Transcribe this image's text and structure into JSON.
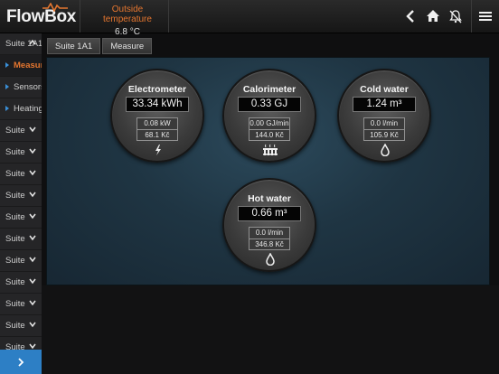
{
  "app": {
    "title": "FlowBox"
  },
  "header": {
    "outside_label": "Outside temperature",
    "outside_value": "6.8 °C",
    "icons": [
      "back-icon",
      "home-icon",
      "alarm-muted-icon",
      "menu-icon"
    ]
  },
  "sidebar": {
    "items": [
      {
        "label": "Suite 1A1",
        "expanded": true
      },
      {
        "label": "Measure",
        "sub": true,
        "active": true
      },
      {
        "label": "Sensors",
        "sub": true
      },
      {
        "label": "Heating",
        "sub": true
      },
      {
        "label": "Suite"
      },
      {
        "label": "Suite"
      },
      {
        "label": "Suite"
      },
      {
        "label": "Suite"
      },
      {
        "label": "Suite"
      },
      {
        "label": "Suite"
      },
      {
        "label": "Suite"
      },
      {
        "label": "Suite"
      },
      {
        "label": "Suite"
      },
      {
        "label": "Suite"
      },
      {
        "label": "Suite"
      }
    ],
    "expand_icon": "chevron-right-icon"
  },
  "breadcrumb": [
    "Suite 1A1",
    "Measure"
  ],
  "meters": {
    "electrometer": {
      "title": "Electrometer",
      "value": "33.34 kWh",
      "rate": "0.08 kW",
      "cost": "68.1 Kč",
      "icon": "lightning-icon"
    },
    "calorimeter": {
      "title": "Calorimeter",
      "value": "0.33 GJ",
      "rate": "0.00 GJ/min",
      "cost": "144.0 Kč",
      "icon": "radiator-icon"
    },
    "cold_water": {
      "title": "Cold water",
      "value": "1.24 m³",
      "rate": "0.0 l/min",
      "cost": "105.9 Kč",
      "icon": "drop-icon"
    },
    "hot_water": {
      "title": "Hot water",
      "value": "0.66 m³",
      "rate": "0.0 l/min",
      "cost": "346.8 Kč",
      "icon": "drop-icon"
    }
  },
  "colors": {
    "accent": "#e5762f",
    "blue": "#2d7fc5"
  }
}
